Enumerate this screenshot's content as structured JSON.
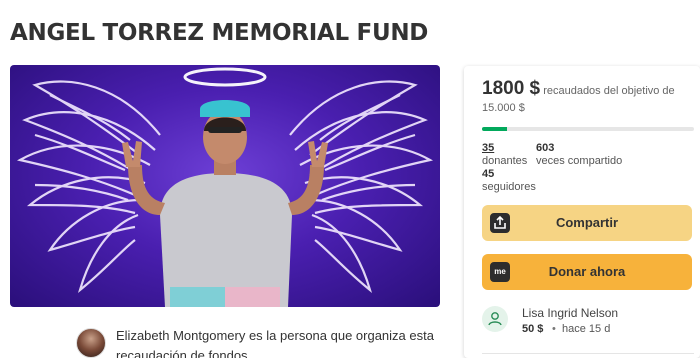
{
  "page": {
    "title": "ANGEL TORREZ MEMORIAL FUND"
  },
  "organizer": {
    "text": "Elizabeth Montgomery es la persona que organiza esta recaudación de fondos."
  },
  "funding": {
    "raised": "1800 $",
    "goal_text": "recaudados del objetivo de 15.000 $",
    "progress": 0.12,
    "accent_color": "#02a95c"
  },
  "stats": {
    "donors_count": "35",
    "donors_label": "donantes",
    "shares_count": "603",
    "shares_label": "veces compartido",
    "followers_count": "45",
    "followers_label": "seguidores"
  },
  "actions": {
    "share_label": "Compartir",
    "share_icon": "share-upload-icon",
    "donate_label": "Donar ahora",
    "donate_icon_text": "me",
    "share_color": "#f6d484",
    "donate_color": "#f7b23b"
  },
  "recent_donation": {
    "name": "Lisa Ingrid Nelson",
    "amount": "50 $",
    "separator": "•",
    "time": "hace 15 d",
    "icon": "donor-heart-hand-icon"
  }
}
